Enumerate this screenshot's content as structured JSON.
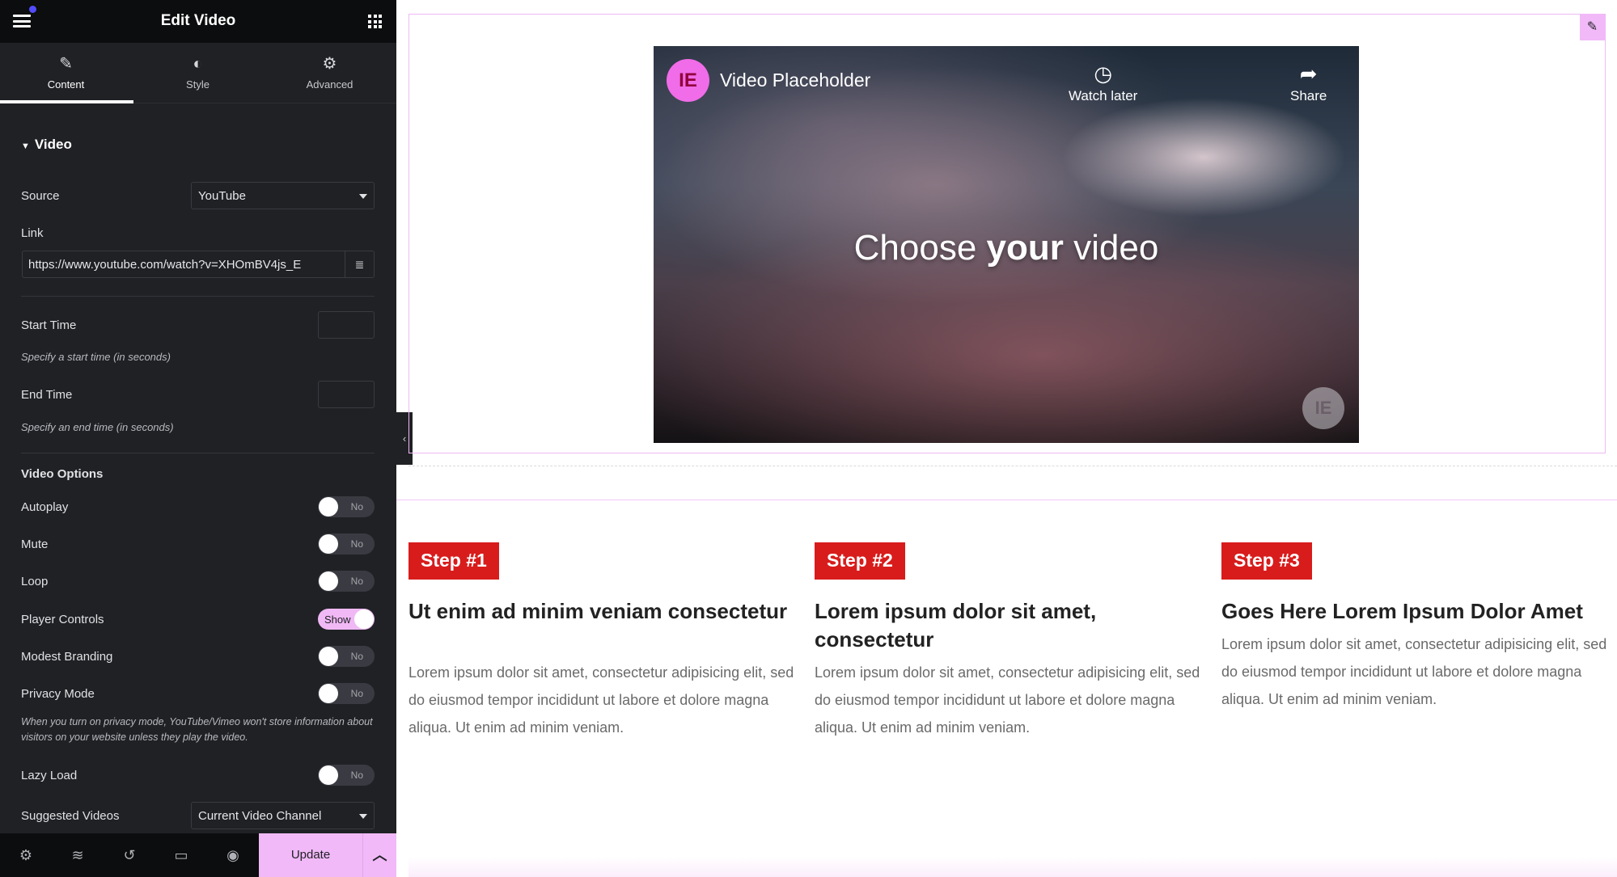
{
  "sidebar": {
    "title": "Edit Video",
    "tabs": [
      {
        "label": "Content",
        "icon": "pencil-icon"
      },
      {
        "label": "Style",
        "icon": "contrast-icon"
      },
      {
        "label": "Advanced",
        "icon": "gear-icon"
      }
    ],
    "active_tab": "Content",
    "section_title": "Video",
    "source": {
      "label": "Source",
      "value": "YouTube"
    },
    "link": {
      "label": "Link",
      "value": "https://www.youtube.com/watch?v=XHOmBV4js_E"
    },
    "start_time": {
      "label": "Start Time",
      "value": "",
      "hint": "Specify a start time (in seconds)"
    },
    "end_time": {
      "label": "End Time",
      "value": "",
      "hint": "Specify an end time (in seconds)"
    },
    "options_title": "Video Options",
    "toggles": [
      {
        "label": "Autoplay",
        "state": "No"
      },
      {
        "label": "Mute",
        "state": "No"
      },
      {
        "label": "Loop",
        "state": "No"
      },
      {
        "label": "Player Controls",
        "state": "Show"
      },
      {
        "label": "Modest Branding",
        "state": "No"
      },
      {
        "label": "Privacy Mode",
        "state": "No"
      }
    ],
    "privacy_note": "When you turn on privacy mode, YouTube/Vimeo won't store information about visitors on your website unless they play the video.",
    "lazy_load": {
      "label": "Lazy Load",
      "state": "No"
    },
    "suggested": {
      "label": "Suggested Videos",
      "value": "Current Video Channel"
    },
    "footer": {
      "update_label": "Update"
    },
    "accent": "#f1b9f8"
  },
  "video": {
    "title": "Video Placeholder",
    "watch_later": "Watch later",
    "share": "Share",
    "headline_pre": "Choose ",
    "headline_bold": "your",
    "headline_post": " video"
  },
  "steps": [
    {
      "badge": "Step #1",
      "title": "Ut enim ad minim veniam consectetur",
      "text": "Lorem ipsum dolor sit amet, consectetur adipisicing elit, sed do eiusmod tempor incididunt ut labore et dolore magna aliqua. Ut enim ad minim veniam."
    },
    {
      "badge": "Step #2",
      "title": "Lorem ipsum dolor sit amet, consectetur",
      "text": "Lorem ipsum dolor sit amet, consectetur adipisicing elit, sed do eiusmod tempor incididunt ut labore et dolore magna aliqua. Ut enim ad minim veniam."
    },
    {
      "badge": "Step #3",
      "title": "Goes Here Lorem Ipsum Dolor Amet",
      "text": "Lorem ipsum dolor sit amet, consectetur adipisicing elit, sed do eiusmod tempor incididunt ut labore et dolore magna aliqua. Ut enim ad minim veniam."
    }
  ],
  "badge_color": "#d81c1c"
}
